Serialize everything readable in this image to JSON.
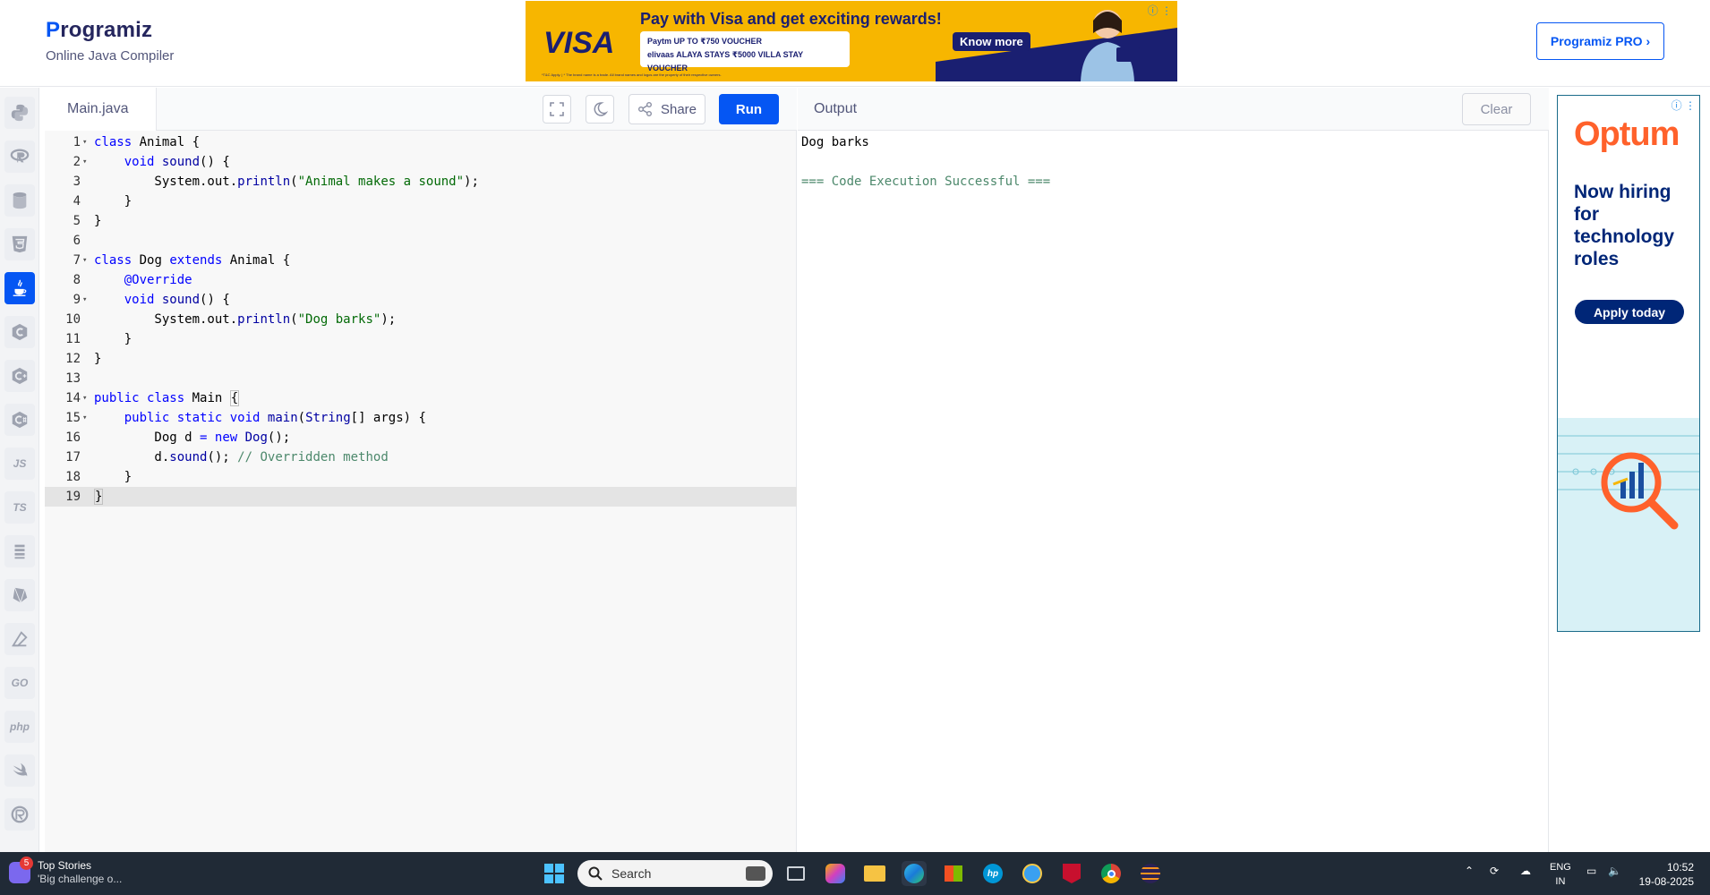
{
  "header": {
    "logo_first_letter": "P",
    "logo_rest": "rogramiz",
    "subtitle": "Online Java Compiler",
    "pro_button": "Programiz PRO ›"
  },
  "ad_top": {
    "brand": "VISA",
    "headline": "Pay with Visa and get exciting rewards!",
    "voucher_line1": "Paytm UP TO ₹750 VOUCHER",
    "voucher_line2": "elivaas  ALAYA STAYS ₹5000 VILLA STAY VOUCHER",
    "cta": "Know more",
    "fine_print": "*T&C Apply. | * The brand name is a trade. All brand names and logos are the property of their respective owners.",
    "icons": "ⓘ ⋮"
  },
  "sidebar": {
    "items": [
      {
        "name": "python",
        "label": ""
      },
      {
        "name": "r",
        "label": ""
      },
      {
        "name": "sql",
        "label": ""
      },
      {
        "name": "html",
        "label": ""
      },
      {
        "name": "java",
        "label": ""
      },
      {
        "name": "c",
        "label": ""
      },
      {
        "name": "cpp",
        "label": ""
      },
      {
        "name": "csharp",
        "label": ""
      },
      {
        "name": "js",
        "label": "JS"
      },
      {
        "name": "ts",
        "label": "TS"
      },
      {
        "name": "kotlin",
        "label": ""
      },
      {
        "name": "ruby",
        "label": ""
      },
      {
        "name": "dsa",
        "label": ""
      },
      {
        "name": "go",
        "label": "GO"
      },
      {
        "name": "php",
        "label": "php"
      },
      {
        "name": "swift",
        "label": ""
      },
      {
        "name": "rust",
        "label": ""
      }
    ]
  },
  "editor": {
    "tab_name": "Main.java",
    "share_label": "Share",
    "run_label": "Run",
    "lines": [
      {
        "n": "1",
        "fold": true,
        "html": "<span class=\"kw\">class</span> Animal {"
      },
      {
        "n": "2",
        "fold": true,
        "html": "    <span class=\"kw\">void</span> <span class=\"fn\">sound</span>() {"
      },
      {
        "n": "3",
        "fold": false,
        "html": "        System.out.<span class=\"fn\">println</span>(<span class=\"str\">\"Animal makes a sound\"</span>);"
      },
      {
        "n": "4",
        "fold": false,
        "html": "    }"
      },
      {
        "n": "5",
        "fold": false,
        "html": "}"
      },
      {
        "n": "6",
        "fold": false,
        "html": ""
      },
      {
        "n": "7",
        "fold": true,
        "html": "<span class=\"kw\">class</span> Dog <span class=\"kw\">extends</span> Animal {"
      },
      {
        "n": "8",
        "fold": false,
        "html": "    <span class=\"an\">@Override</span>"
      },
      {
        "n": "9",
        "fold": true,
        "html": "    <span class=\"kw\">void</span> <span class=\"fn\">sound</span>() {"
      },
      {
        "n": "10",
        "fold": false,
        "html": "        System.out.<span class=\"fn\">println</span>(<span class=\"str\">\"Dog barks\"</span>);"
      },
      {
        "n": "11",
        "fold": false,
        "html": "    }"
      },
      {
        "n": "12",
        "fold": false,
        "html": "}"
      },
      {
        "n": "13",
        "fold": false,
        "html": ""
      },
      {
        "n": "14",
        "fold": true,
        "html": "<span class=\"kw\">public</span> <span class=\"kw\">class</span> Main <span class=\"cursor-bracket\">{</span>"
      },
      {
        "n": "15",
        "fold": true,
        "html": "    <span class=\"kw\">public</span> <span class=\"kw\">static</span> <span class=\"kw\">void</span> <span class=\"fn\">main</span>(<span class=\"fn\">String</span>[] args) {"
      },
      {
        "n": "16",
        "fold": false,
        "html": "        Dog d <span class=\"kw\">=</span> <span class=\"kw\">new</span> <span class=\"fn\">Dog</span>();"
      },
      {
        "n": "17",
        "fold": false,
        "html": "        d.<span class=\"fn\">sound</span>(); <span class=\"cm\">// Overridden method</span>"
      },
      {
        "n": "18",
        "fold": false,
        "html": "    }"
      },
      {
        "n": "19",
        "fold": false,
        "html": "<span class=\"cursor-bracket\">}</span>",
        "current": true
      }
    ]
  },
  "output": {
    "title": "Output",
    "clear_label": "Clear",
    "lines": [
      "Dog barks",
      "",
      "=== Code Execution Successful ==="
    ]
  },
  "ad_right": {
    "brand": "Optum",
    "headline": "Now hiring for technology roles",
    "cta": "Apply today",
    "icons": "ⓘ ⋮"
  },
  "taskbar": {
    "news_badge": "5",
    "news_title": "Top Stories",
    "news_sub": "'Big challenge o...",
    "search_placeholder": "Search",
    "lang_top": "ENG",
    "lang_bottom": "IN",
    "time": "10:52",
    "date": "19-08-2025"
  },
  "colors": {
    "accent": "#0556f3",
    "taskbar": "#202a36",
    "visa_yellow": "#f7b600",
    "optum_orange": "#ff612b"
  }
}
